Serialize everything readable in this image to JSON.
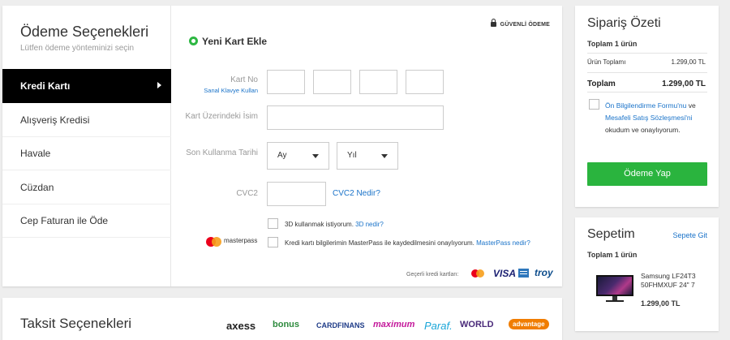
{
  "payment": {
    "title": "Ödeme Seçenekleri",
    "subtitle": "Lütfen ödeme yönteminizi seçin",
    "methods": [
      {
        "label": "Kredi Kartı"
      },
      {
        "label": "Alışveriş Kredisi"
      },
      {
        "label": "Havale"
      },
      {
        "label": "Cüzdan"
      },
      {
        "label": "Cep Faturan ile Öde"
      }
    ],
    "active_method": "Kredi Kartı",
    "secure_label": "GÜVENLİ ÖDEME",
    "new_card_label": "Yeni Kart Ekle",
    "card_no_label": "Kart No",
    "virtual_keyboard_link": "Sanal Klavye Kullan",
    "card_name_label": "Kart Üzerindeki İsim",
    "expiry_label": "Son Kullanma Tarihi",
    "month_placeholder": "Ay",
    "year_placeholder": "Yıl",
    "cvc_label": "CVC2",
    "cvc_link": "CVC2 Nedir?",
    "secure3d_text": "3D kullanmak istiyorum.",
    "secure3d_link": "3D nedir?",
    "masterpass_logo": "masterpass",
    "masterpass_text": "Kredi kartı bilgilerimin MasterPass ile kaydedilmesini onaylıyorum.",
    "masterpass_link": "MasterPass nedir?",
    "valid_cards_label": "Geçerli kredi kartları:",
    "card_brands": [
      "VISA",
      "troy"
    ]
  },
  "installments": {
    "title": "Taksit Seçenekleri",
    "banks": [
      {
        "name": "axess",
        "color": "#222222"
      },
      {
        "name": "bonus",
        "color": "#2e8b3e"
      },
      {
        "name": "CARDFINANS",
        "color": "#1f3c88"
      },
      {
        "name": "maximum",
        "color": "#c4199b"
      },
      {
        "name": "Paraf.",
        "color": "#1aa6d8"
      },
      {
        "name": "WORLD",
        "color": "#4a2a7a"
      },
      {
        "name": "advantage",
        "color": "#f07d00"
      }
    ]
  },
  "summary": {
    "title": "Sipariş Özeti",
    "count": "Toplam 1 ürün",
    "subtotal_label": "Ürün Toplamı",
    "subtotal_value": "1.299,00 TL",
    "total_label": "Toplam",
    "total_value": "1.299,00 TL",
    "agree_link1": "Ön Bilgilendirme Formu'nu",
    "agree_mid": " ve ",
    "agree_link2": "Mesafeli Satış Sözleşmesi'ni",
    "agree_end": " okudum ve onaylıyorum.",
    "pay_button": "Ödeme Yap"
  },
  "cart": {
    "title": "Sepetim",
    "go_link": "Sepete Git",
    "count": "Toplam 1 ürün",
    "product_name": "Samsung LF24T3 50FHMXUF 24\" 7",
    "product_price": "1.299,00 TL"
  },
  "colors": {
    "accent_green": "#2ab43e",
    "link_blue": "#1a73c9",
    "active_bg": "#000000"
  }
}
